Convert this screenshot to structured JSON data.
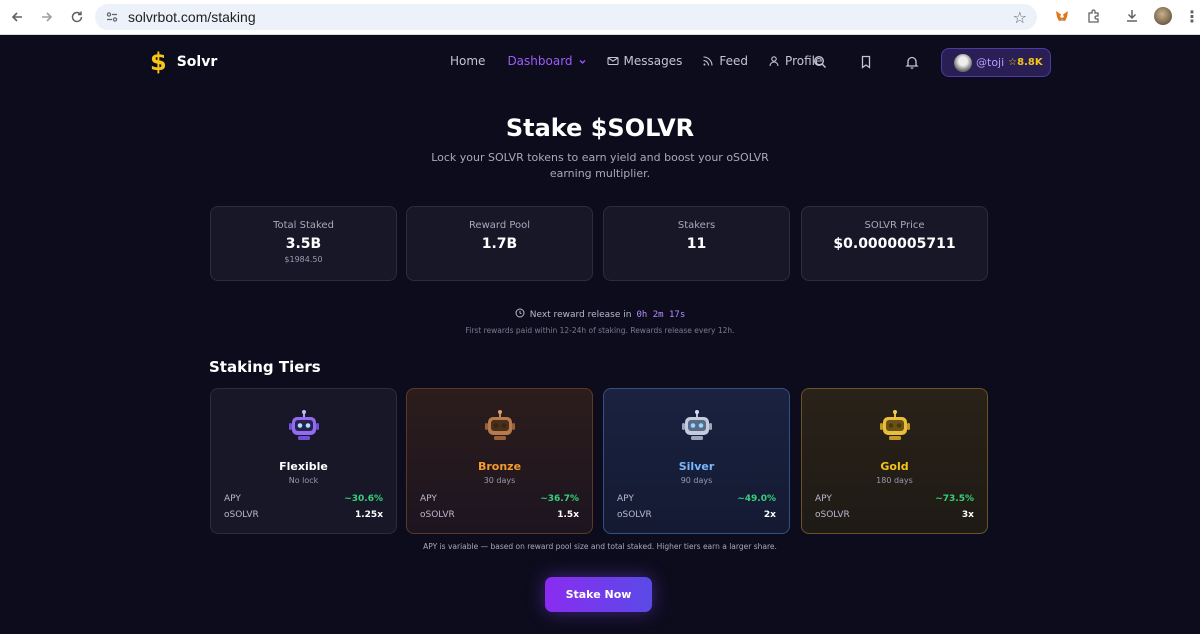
{
  "browser": {
    "url": "solvrbot.com/staking",
    "back_icon": "arrow-left-icon",
    "forward_icon": "arrow-right-icon",
    "reload_icon": "reload-icon"
  },
  "nav": {
    "brand": "Solvr",
    "brand_mark": "$",
    "items": [
      {
        "label": "Home",
        "icon": ""
      },
      {
        "label": "Dashboard",
        "icon": "chevron-down-icon",
        "active": true
      },
      {
        "label": "Messages",
        "icon": "mail-icon"
      },
      {
        "label": "Feed",
        "icon": "rss-icon"
      },
      {
        "label": "Profile",
        "icon": "user-icon"
      }
    ],
    "user": {
      "handle": "@toji",
      "points": "☆8.8K"
    }
  },
  "hero": {
    "title": "Stake $SOLVR",
    "subtitle": "Lock your SOLVR tokens to earn yield and boost your oSOLVR earning multiplier."
  },
  "stats": [
    {
      "label": "Total Staked",
      "value": "3.5B",
      "sub": "$1984.50"
    },
    {
      "label": "Reward Pool",
      "value": "1.7B",
      "sub": ""
    },
    {
      "label": "Stakers",
      "value": "11",
      "sub": ""
    },
    {
      "label": "SOLVR Price",
      "value": "$0.0000005711",
      "sub": ""
    }
  ],
  "reward": {
    "label": "Next reward release in",
    "countdown": "0h 2m 17s",
    "note": "First rewards paid within 12-24h of staking. Rewards release every 12h."
  },
  "tiers_heading": "Staking Tiers",
  "tiers": [
    {
      "name": "Flexible",
      "lock": "No lock",
      "apy_label": "APY",
      "apy": "~30.6%",
      "mult_label": "oSOLVR",
      "mult": "1.25x",
      "color": "#ffffff"
    },
    {
      "name": "Bronze",
      "lock": "30 days",
      "apy_label": "APY",
      "apy": "~36.7%",
      "mult_label": "oSOLVR",
      "mult": "1.5x",
      "color": "#f59a2e"
    },
    {
      "name": "Silver",
      "lock": "90 days",
      "apy_label": "APY",
      "apy": "~49.0%",
      "mult_label": "oSOLVR",
      "mult": "2x",
      "color": "#7ab8ff"
    },
    {
      "name": "Gold",
      "lock": "180 days",
      "apy_label": "APY",
      "apy": "~73.5%",
      "mult_label": "oSOLVR",
      "mult": "3x",
      "color": "#f5c518"
    }
  ],
  "apy_note": "APY is variable — based on reward pool size and total staked. Higher tiers earn a larger share.",
  "cta": {
    "label": "Stake Now"
  },
  "colors": {
    "accent": "#9b5cf6",
    "apy_green": "#34d17a",
    "gold": "#f5c518"
  }
}
